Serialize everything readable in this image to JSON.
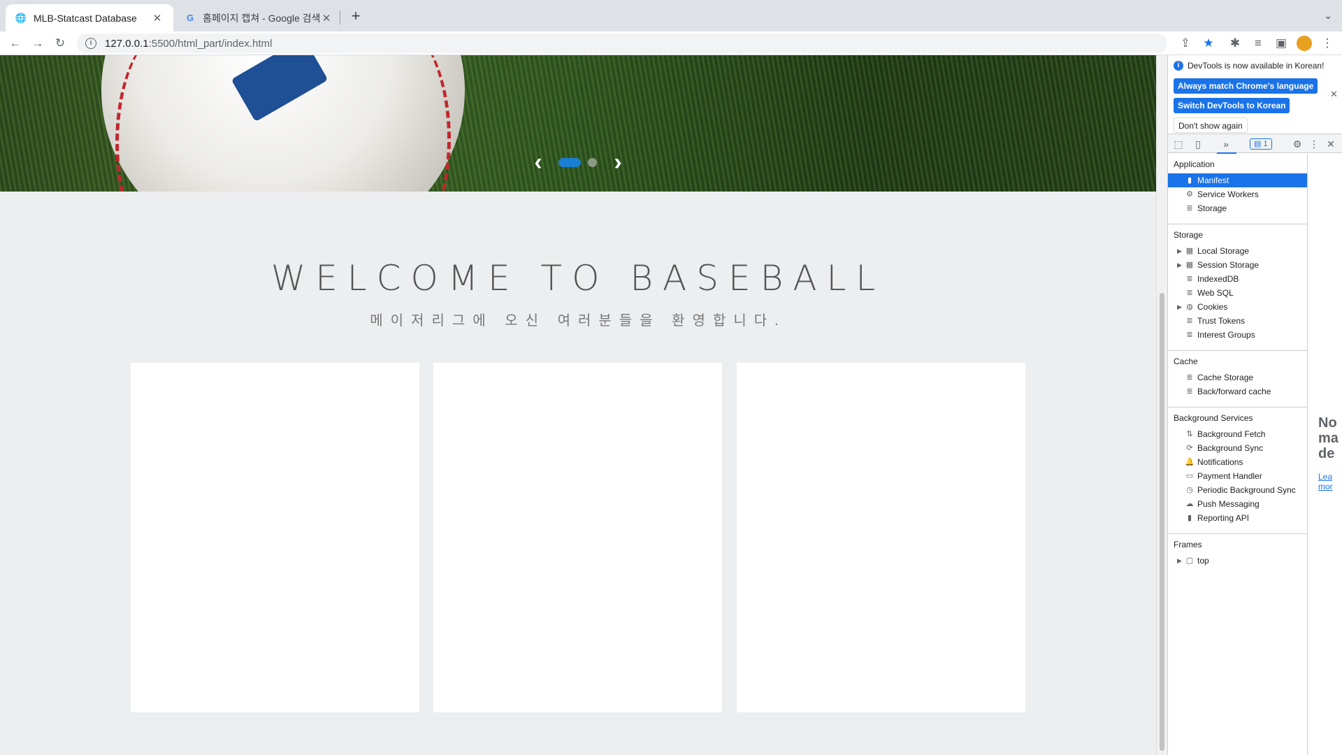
{
  "browser": {
    "tabs": [
      {
        "title": "MLB-Statcast Database",
        "active": true,
        "favicon": "globe-icon"
      },
      {
        "title": "홈페이지 캡쳐 - Google 검색",
        "active": false,
        "favicon": "google-icon"
      }
    ],
    "url_host": "127.0.0.1",
    "url_path": ":5500/html_part/index.html"
  },
  "page": {
    "welcome_title": "WELCOME TO BASEBALL",
    "welcome_subtitle": "메이저리그에 오신 여러분들을 환영합니다.",
    "carousel": {
      "slides": 2,
      "active_slide": 1
    }
  },
  "devtools": {
    "banner": {
      "message": "DevTools is now available in Korean!",
      "btn_match": "Always match Chrome's language",
      "btn_switch": "Switch DevTools to Korean",
      "btn_dont": "Don't show again"
    },
    "issues_count": "1",
    "sections": {
      "application": "Application",
      "storage": "Storage",
      "cache": "Cache",
      "background": "Background Services",
      "frames": "Frames"
    },
    "application_items": [
      "Manifest",
      "Service Workers",
      "Storage"
    ],
    "storage_items": [
      "Local Storage",
      "Session Storage",
      "IndexedDB",
      "Web SQL",
      "Cookies",
      "Trust Tokens",
      "Interest Groups"
    ],
    "cache_items": [
      "Cache Storage",
      "Back/forward cache"
    ],
    "background_items": [
      "Background Fetch",
      "Background Sync",
      "Notifications",
      "Payment Handler",
      "Periodic Background Sync",
      "Push Messaging",
      "Reporting API"
    ],
    "frames_items": [
      "top"
    ],
    "right_panel_text": "No\nma\nde",
    "right_panel_link": "Lea\nmor"
  },
  "colors": {
    "accent": "#1a73e8",
    "carousel_active": "#1a7fd1"
  }
}
